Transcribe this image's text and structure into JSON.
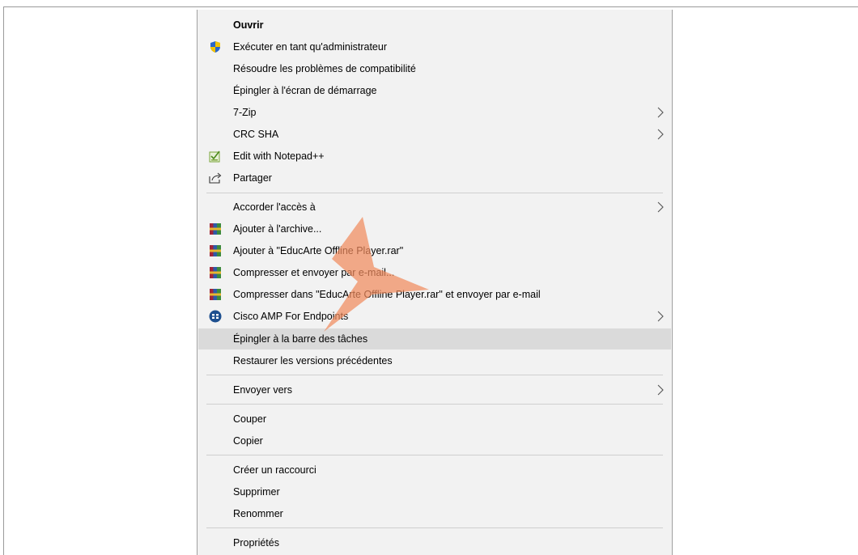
{
  "menu": {
    "items": [
      {
        "label": "Ouvrir",
        "icon": "",
        "bold": true,
        "submenu": false
      },
      {
        "label": "Exécuter en tant qu'administrateur",
        "icon": "uac-shield-icon",
        "bold": false,
        "submenu": false
      },
      {
        "label": "Résoudre les problèmes de compatibilité",
        "icon": "",
        "bold": false,
        "submenu": false
      },
      {
        "label": "Épingler à l'écran de démarrage",
        "icon": "",
        "bold": false,
        "submenu": false
      },
      {
        "label": "7-Zip",
        "icon": "",
        "bold": false,
        "submenu": true
      },
      {
        "label": "CRC SHA",
        "icon": "",
        "bold": false,
        "submenu": true
      },
      {
        "label": "Edit with Notepad++",
        "icon": "notepadpp-icon",
        "bold": false,
        "submenu": false
      },
      {
        "label": "Partager",
        "icon": "share-icon",
        "bold": false,
        "submenu": false
      },
      {
        "label": "Accorder l'accès à",
        "icon": "",
        "bold": false,
        "submenu": true
      },
      {
        "label": "Ajouter à l'archive...",
        "icon": "winrar-icon",
        "bold": false,
        "submenu": false
      },
      {
        "label": "Ajouter à \"EducArte Offline Player.rar\"",
        "icon": "winrar-icon",
        "bold": false,
        "submenu": false
      },
      {
        "label": "Compresser et envoyer par e-mail...",
        "icon": "winrar-icon",
        "bold": false,
        "submenu": false
      },
      {
        "label": "Compresser dans \"EducArte Offline Player.rar\" et envoyer par e-mail",
        "icon": "winrar-icon",
        "bold": false,
        "submenu": false
      },
      {
        "label": "Cisco AMP For Endpoints",
        "icon": "cisco-amp-icon",
        "bold": false,
        "submenu": true
      },
      {
        "label": "Épingler à la barre des tâches",
        "icon": "",
        "bold": false,
        "submenu": false,
        "highlighted": true
      },
      {
        "label": "Restaurer les versions précédentes",
        "icon": "",
        "bold": false,
        "submenu": false
      },
      {
        "label": "Envoyer vers",
        "icon": "",
        "bold": false,
        "submenu": true
      },
      {
        "label": "Couper",
        "icon": "",
        "bold": false,
        "submenu": false
      },
      {
        "label": "Copier",
        "icon": "",
        "bold": false,
        "submenu": false
      },
      {
        "label": "Créer un raccourci",
        "icon": "",
        "bold": false,
        "submenu": false
      },
      {
        "label": "Supprimer",
        "icon": "",
        "bold": false,
        "submenu": false
      },
      {
        "label": "Renommer",
        "icon": "",
        "bold": false,
        "submenu": false
      },
      {
        "label": "Propriétés",
        "icon": "",
        "bold": false,
        "submenu": false
      }
    ]
  },
  "colors": {
    "menu_bg": "#f2f2f2",
    "highlight": "#dadada",
    "separator": "#cfcfcf",
    "pointer": "#f08a5d"
  }
}
